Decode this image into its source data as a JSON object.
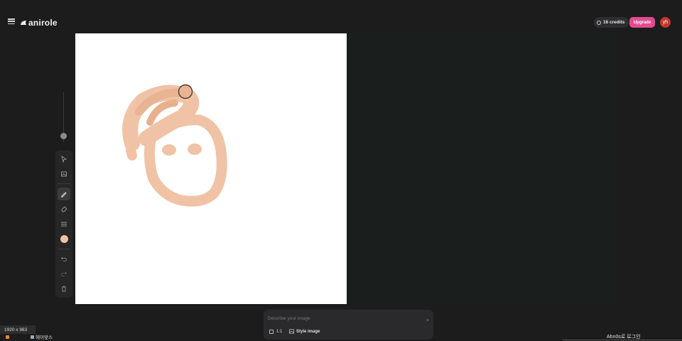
{
  "header": {
    "brand": "anirole",
    "credits_label": "16 credits",
    "upgrade_label": "Upgrade",
    "avatar_initials": "yh"
  },
  "brush": {
    "color": "#f2c1a3"
  },
  "prompt": {
    "placeholder": "Describe your image",
    "ratio_label": "1:1",
    "style_label": "Style image"
  },
  "status": {
    "dimensions": "1920 x 963",
    "app_label": "헤이맞스",
    "login_text": "Ahn0s로 로그인"
  },
  "colors": {
    "accent": "#e24c8f",
    "avatar": "#c0392b",
    "canvas_bg": "#ffffff",
    "app_bg": "#1c1c1d"
  }
}
